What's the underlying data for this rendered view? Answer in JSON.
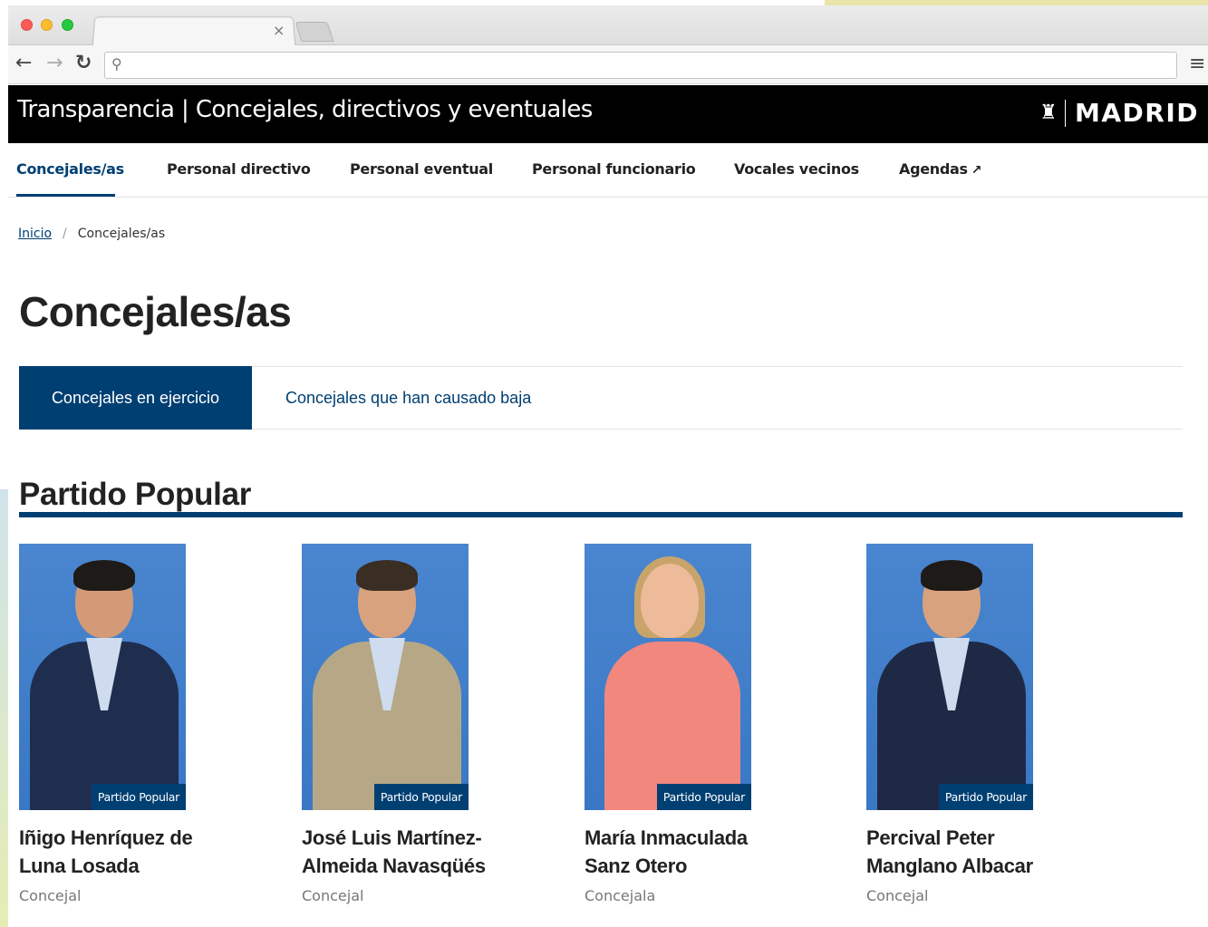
{
  "site": {
    "title": "Transparencia | Concejales, directivos y eventuales",
    "logo_text": "MADRID"
  },
  "nav": {
    "items": [
      {
        "label": "Concejales/as",
        "active": true
      },
      {
        "label": "Personal directivo"
      },
      {
        "label": "Personal eventual"
      },
      {
        "label": "Personal funcionario"
      },
      {
        "label": "Vocales vecinos"
      },
      {
        "label": "Agendas"
      }
    ]
  },
  "breadcrumb": {
    "home": "Inicio",
    "separator": "/",
    "current": "Concejales/as"
  },
  "page": {
    "title": "Concejales/as"
  },
  "tabs": [
    {
      "label": "Concejales en ejercicio",
      "active": true
    },
    {
      "label": "Concejales que han causado baja"
    }
  ],
  "section": {
    "title": "Partido Popular"
  },
  "cards": [
    {
      "badge": "Partido Popular",
      "name_line1": "Iñigo Henríquez de",
      "name_line2": "Luna Losada",
      "role": "Concejal"
    },
    {
      "badge": "Partido Popular",
      "name_line1": "José Luis Martínez-",
      "name_line2": "Almeida Navasqüés",
      "role": "Concejal"
    },
    {
      "badge": "Partido Popular",
      "name_line1": "María Inmaculada",
      "name_line2": "Sanz Otero",
      "role": "Concejala"
    },
    {
      "badge": "Partido Popular",
      "name_line1": "Percival Peter",
      "name_line2": "Manglano Albacar",
      "role": "Concejal"
    }
  ],
  "colors": {
    "accent": "#003f72",
    "header_bg": "#000000",
    "photo_bg": "#3a77c4"
  },
  "icons": {
    "close": "close-icon",
    "back": "back-arrow-icon",
    "forward": "forward-arrow-icon",
    "reload": "reload-icon",
    "search": "search-icon",
    "menu": "hamburger-menu-icon",
    "external": "external-link-icon",
    "shield": "madrid-shield-icon"
  }
}
